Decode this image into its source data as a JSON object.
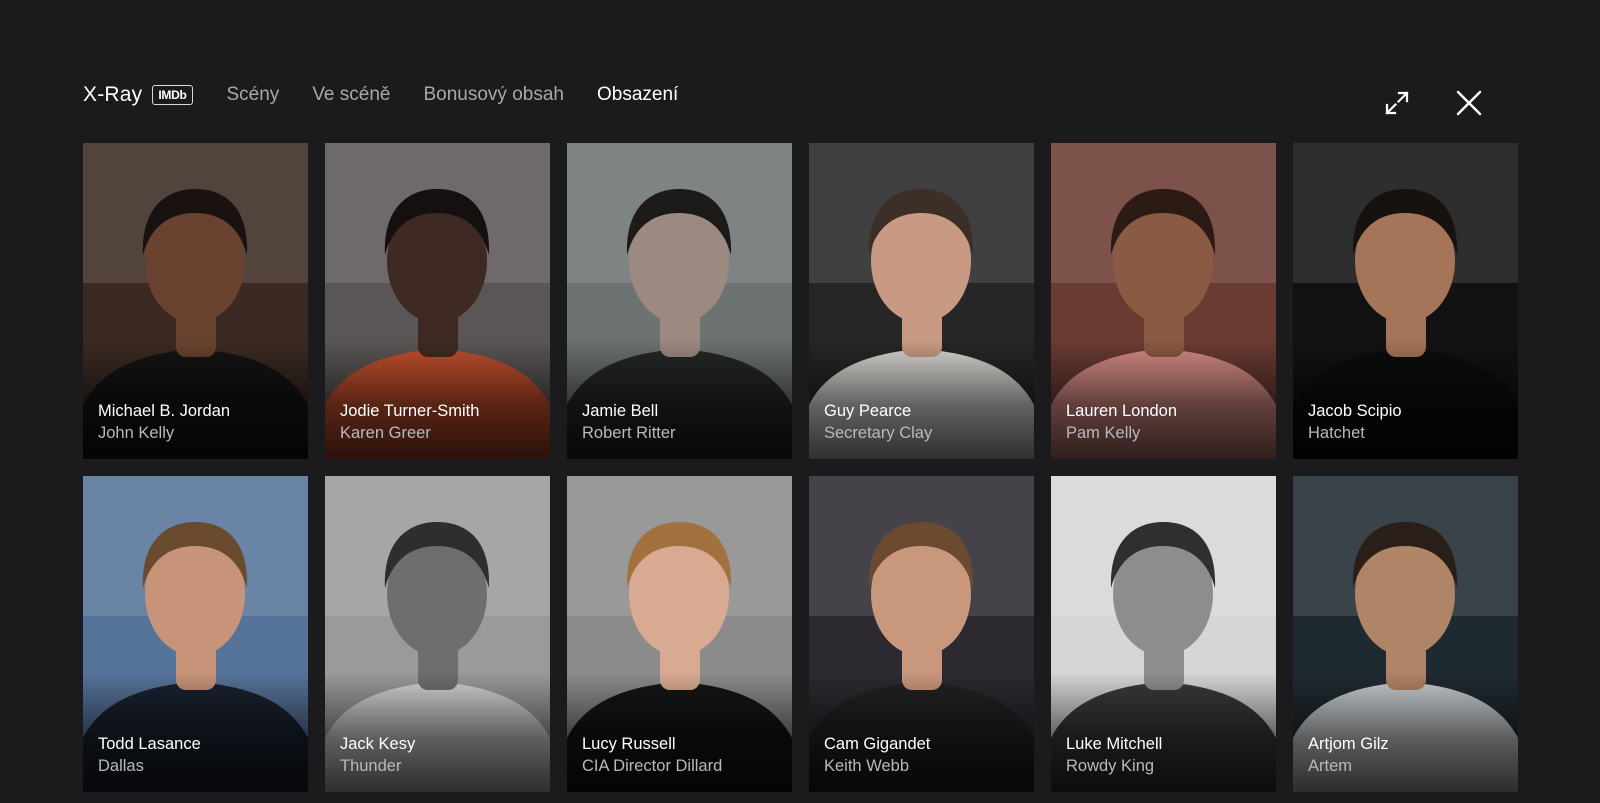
{
  "header": {
    "brand_title": "X-Ray",
    "imdb_badge": "IMDb",
    "tabs": [
      {
        "label": "Scény",
        "active": false
      },
      {
        "label": "Ve scéně",
        "active": false
      },
      {
        "label": "Bonusový obsah",
        "active": false
      },
      {
        "label": "Obsazení",
        "active": true
      }
    ],
    "actions": [
      {
        "icon": "fullscreen-icon"
      },
      {
        "icon": "close-icon"
      }
    ]
  },
  "cast": [
    {
      "actor": "Michael B. Jordan",
      "role": "John Kelly",
      "backdrop": "#3b2a22",
      "skin": "#6a4330",
      "hair": "#1a1210",
      "clothing": "#141414"
    },
    {
      "actor": "Jodie Turner-Smith",
      "role": "Karen Greer",
      "backdrop": "#5a5655",
      "skin": "#3e2a22",
      "hair": "#141010",
      "clothing": "#c4502e"
    },
    {
      "actor": "Jamie Bell",
      "role": "Robert Ritter",
      "backdrop": "#6c7372",
      "skin": "#9c8a80",
      "hair": "#1d1b1a",
      "clothing": "#262727"
    },
    {
      "actor": "Guy Pearce",
      "role": "Secretary Clay",
      "backdrop": "#262626",
      "skin": "#c89a84",
      "hair": "#3d2f27",
      "clothing": "#dad8d4"
    },
    {
      "actor": "Lauren London",
      "role": "Pam Kelly",
      "backdrop": "#6a3b33",
      "skin": "#8a5a43",
      "hair": "#2b1b14",
      "clothing": "#d88c86"
    },
    {
      "actor": "Jacob Scipio",
      "role": "Hatchet",
      "backdrop": "#121212",
      "skin": "#a67459",
      "hair": "#161210",
      "clothing": "#0c0c0c"
    },
    {
      "actor": "Todd Lasance",
      "role": "Dallas",
      "backdrop": "#56739a",
      "skin": "#c79479",
      "hair": "#6a4a2e",
      "clothing": "#1a2230"
    },
    {
      "actor": "Jack Kesy",
      "role": "Thunder",
      "backdrop": "#9a9a9a",
      "skin": "#6e6e6e",
      "hair": "#2e2e2e",
      "clothing": "#d2d2d2"
    },
    {
      "actor": "Lucy Russell",
      "role": "CIA Director Dillard",
      "backdrop": "#8b8b8b",
      "skin": "#d8aa92",
      "hair": "#a3703f",
      "clothing": "#151515"
    },
    {
      "actor": "Cam Gigandet",
      "role": "Keith Webb",
      "backdrop": "#2c2a30",
      "skin": "#c9987c",
      "hair": "#6b4a30",
      "clothing": "#222222"
    },
    {
      "actor": "Luke Mitchell",
      "role": "Rowdy King",
      "backdrop": "#d6d6d6",
      "skin": "#8d8d8d",
      "hair": "#2f2f2f",
      "clothing": "#3a3a3a"
    },
    {
      "actor": "Artjom Gilz",
      "role": "Artem",
      "backdrop": "#1f2a30",
      "skin": "#b08466",
      "hair": "#2a1f18",
      "clothing": "#c9cdd0"
    }
  ]
}
